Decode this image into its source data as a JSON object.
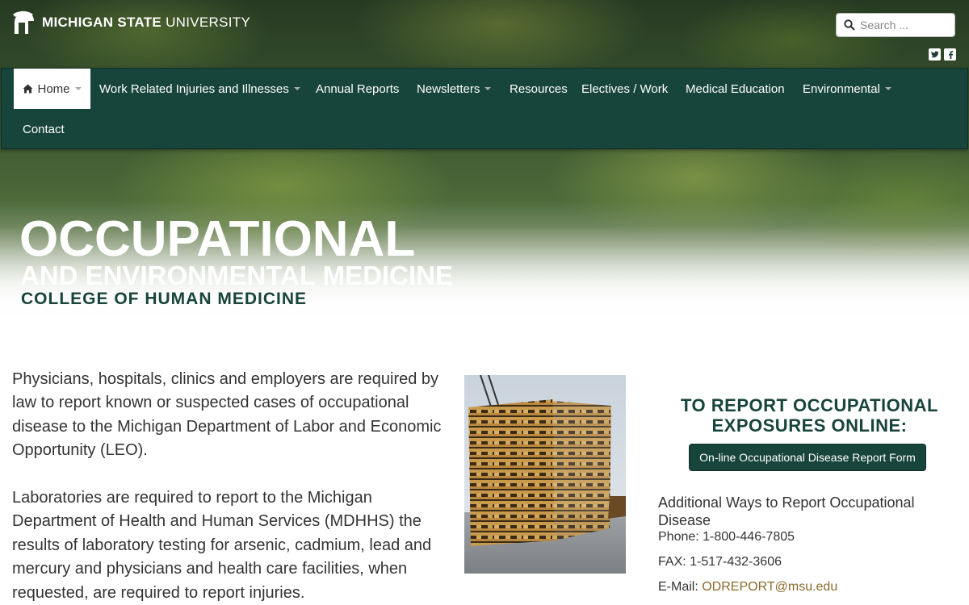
{
  "header": {
    "brand_bold": "MICHIGAN STATE",
    "brand_light": "UNIVERSITY",
    "search_placeholder": "Search ..."
  },
  "nav": {
    "items": [
      {
        "label": "Home",
        "dropdown": true,
        "active": true
      },
      {
        "label": "Work Related Injuries and Illnesses",
        "dropdown": true
      },
      {
        "label": "Annual Reports",
        "dropdown": false
      },
      {
        "label": "Newsletters",
        "dropdown": true
      },
      {
        "label": "Resources",
        "dropdown": false
      },
      {
        "label": "Electives / Work",
        "dropdown": false
      },
      {
        "label": "Medical Education",
        "dropdown": false
      },
      {
        "label": "Environmental",
        "dropdown": true
      },
      {
        "label": "Contact",
        "dropdown": false
      }
    ]
  },
  "hero": {
    "title": "OCCUPATIONAL",
    "subtitle": "AND ENVIRONMENTAL MEDICINE",
    "college": "COLLEGE OF HUMAN MEDICINE"
  },
  "main": {
    "paragraph1": "Physicians, hospitals, clinics and employers are required by law to report known or suspected cases of occupational disease to the Michigan Department of Labor and Economic Opportunity (LEO).",
    "paragraph2": "Laboratories are required to report to the Michigan Department of Health and Human Services (MDHHS) the results of laboratory testing for arsenic, cadmium, lead and mercury and physicians and health care facilities, when requested, are required to report injuries."
  },
  "sidebar": {
    "heading_line1": "TO REPORT OCCUPATIONAL",
    "heading_line2": "EXPOSURES ONLINE:",
    "button_label": "On-line Occupational Disease Report Form",
    "sub_heading": "Additional Ways to Report Occupational Disease",
    "phone": "Phone: 1-800-446-7805",
    "fax": "FAX: 1-517-432-3606",
    "email_label": "E-Mail: ",
    "email": "ODREPORT@msu.edu"
  },
  "colors": {
    "msu_green": "#18453b",
    "link_gold": "#8a6a2a"
  },
  "icons": [
    "spartan-helmet-icon",
    "search-icon",
    "twitter-icon",
    "facebook-icon",
    "home-icon",
    "chevron-down-icon"
  ]
}
